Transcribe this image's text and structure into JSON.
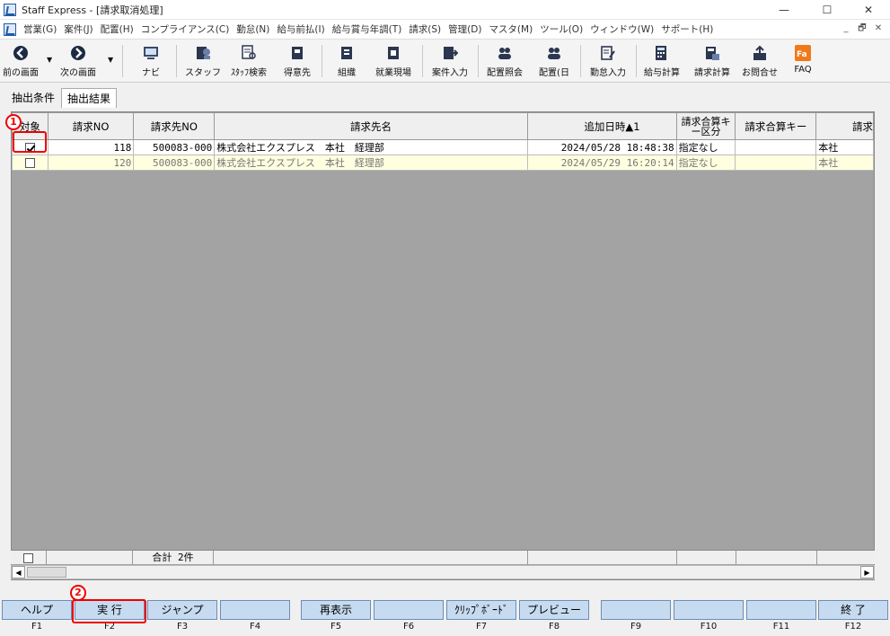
{
  "window": {
    "title": "Staff Express - [請求取消処理]",
    "minimize": "—",
    "maximize": "☐",
    "close": "✕"
  },
  "menu": [
    "営業(G)",
    "案件(J)",
    "配置(H)",
    "コンプライアンス(C)",
    "勤怠(N)",
    "給与前払(I)",
    "給与賞与年調(T)",
    "請求(S)",
    "管理(D)",
    "マスタ(M)",
    "ツール(O)",
    "ウィンドウ(W)",
    "サポート(H)"
  ],
  "mdi": {
    "minimize": "_",
    "restore": "🗗",
    "close": "✕"
  },
  "toolbar": {
    "prev": "前の画面",
    "next": "次の画面",
    "navi": "ナビ",
    "staff": "スタッフ",
    "staff_search": "ｽﾀｯﾌ検索",
    "client": "得意先",
    "org": "組織",
    "site": "就業現場",
    "case_input": "案件入力",
    "assign_inquiry": "配置照会",
    "assign_day": "配置(日",
    "attendance_input": "勤怠入力",
    "payroll_calc": "給与計算",
    "billing_calc": "請求計算",
    "inquiry": "お問合せ",
    "faq": "FAQ"
  },
  "tabs": {
    "conditions": "抽出条件",
    "results": "抽出結果"
  },
  "table": {
    "headers": {
      "target": "対象",
      "billing_no": "請求NO",
      "billing_to_no": "請求先NO",
      "billing_to_name": "請求先名",
      "added_at": "追加日時▲1",
      "sum_key_type": "請求合算キー区分",
      "sum_key": "請求合算キー",
      "billing_next": "請求"
    },
    "rows": [
      {
        "billing_no": "118",
        "billing_to_no": "500083-000",
        "billing_to_name": "株式会社エクスプレス　本社　経理部",
        "added_at": "2024/05/28 18:48:38",
        "sum_key_type": "指定なし",
        "sum_key": "",
        "billing_next": "本社"
      },
      {
        "billing_no": "120",
        "billing_to_no": "500083-000",
        "billing_to_name": "株式会社エクスプレス　本社　経理部",
        "added_at": "2024/05/29 16:20:14",
        "sum_key_type": "指定なし",
        "sum_key": "",
        "billing_next": "本社"
      }
    ],
    "total": "合計 2件"
  },
  "fkeys": {
    "f1": {
      "label": "ヘルプ",
      "key": "F1"
    },
    "f2": {
      "label": "実 行",
      "key": "F2"
    },
    "f3": {
      "label": "ジャンプ",
      "key": "F3"
    },
    "f4": {
      "label": "",
      "key": "F4"
    },
    "f5": {
      "label": "再表示",
      "key": "F5"
    },
    "f6": {
      "label": "",
      "key": "F6"
    },
    "f7": {
      "label": "ｸﾘｯﾌﾟﾎﾞｰﾄﾞ",
      "key": "F7"
    },
    "f8": {
      "label": "プレビュー",
      "key": "F8"
    },
    "f9": {
      "label": "",
      "key": "F9"
    },
    "f10": {
      "label": "",
      "key": "F10"
    },
    "f11": {
      "label": "",
      "key": "F11"
    },
    "f12": {
      "label": "終 了",
      "key": "F12"
    }
  },
  "callouts": {
    "one": "1",
    "two": "2"
  },
  "colors": {
    "accent_red": "#e00000",
    "fkey_blue": "#c7dbf0",
    "row_highlight": "#ffffe0"
  }
}
